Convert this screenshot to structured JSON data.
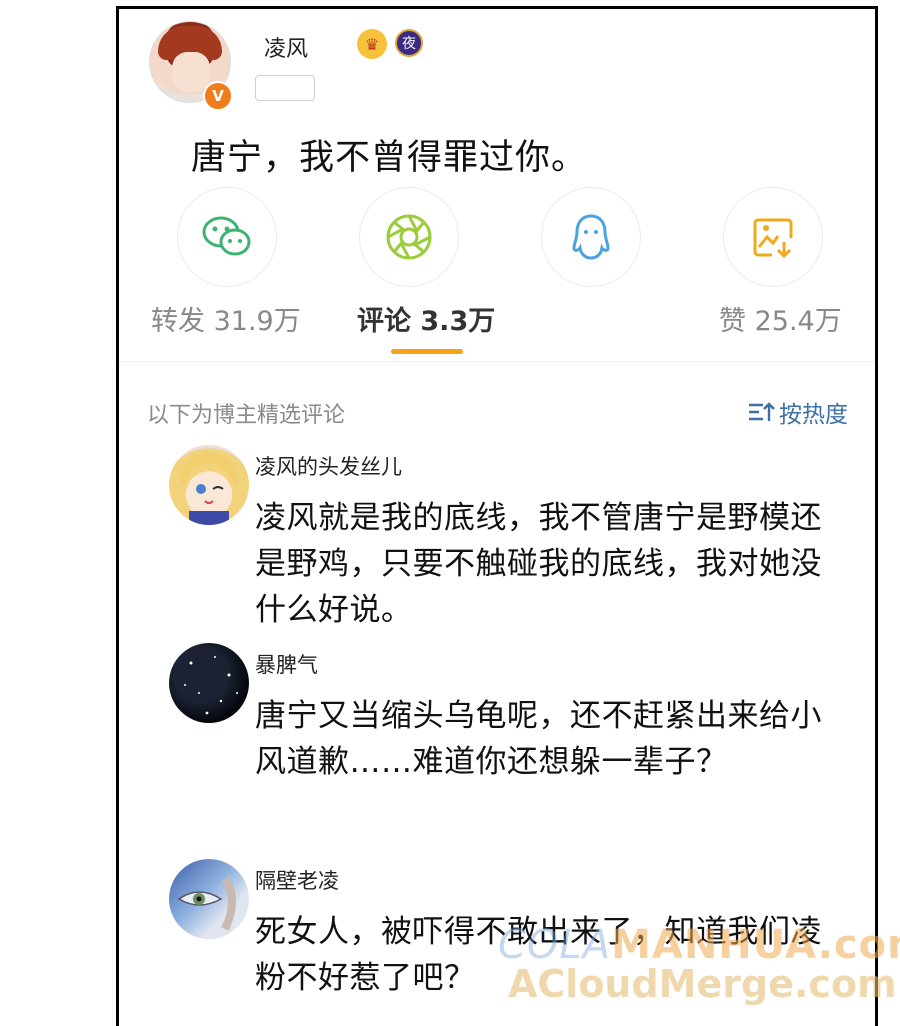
{
  "post": {
    "username": "凌风",
    "crown_glyph": "♛",
    "night_badge": "夜",
    "verified_badge": "V",
    "text": "唐宁，我不曾得罪过你。"
  },
  "share_icons": [
    "wechat-icon",
    "moments-icon",
    "qq-icon",
    "save-image-icon"
  ],
  "stats": {
    "repost": "转发 31.9万",
    "comments": "评论 3.3万",
    "likes": "赞 25.4万"
  },
  "comments_section": {
    "label": "以下为博主精选评论",
    "sort_label": "按热度"
  },
  "comments": [
    {
      "name": "凌风的头发丝儿",
      "text": "凌风就是我的底线，我不管唐宁是野模还是野鸡，只要不触碰我的底线，我对她没什么好说。"
    },
    {
      "name": "暴脾气",
      "text": "唐宁又当缩头乌龟呢，还不赶紧出来给小风道歉……难道你还想躲一辈子？"
    },
    {
      "name": "隔壁老凌",
      "text": "死女人，被吓得不敢出来了，知道我们凌粉不好惹了吧？"
    }
  ],
  "watermark": {
    "line1_a": "COLA",
    "line1_b": "MANHUA.com",
    "line2": "ACloudMerge.com"
  },
  "colors": {
    "accent": "#f7a21b",
    "link": "#3d6fa8",
    "wechat": "#3cb371",
    "qq": "#4aa3df",
    "save": "#f0a81c"
  }
}
